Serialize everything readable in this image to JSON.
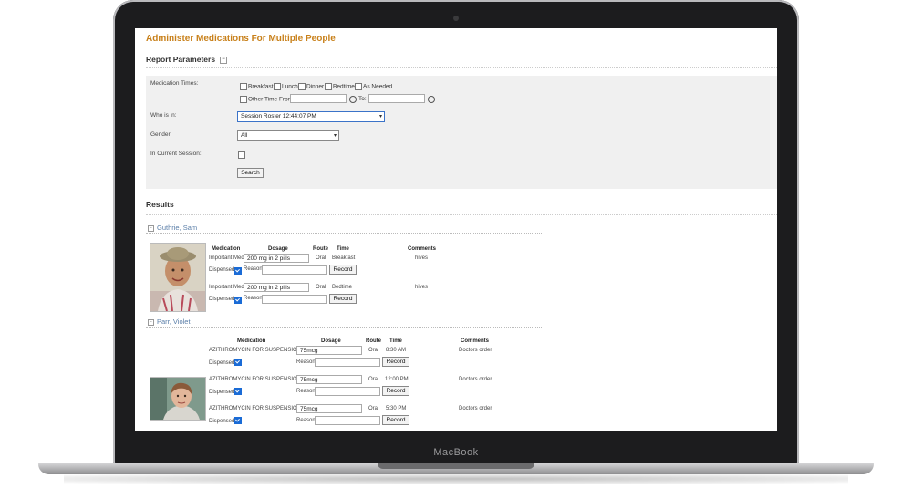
{
  "device": {
    "brand": "MacBook"
  },
  "page": {
    "title": "Administer Medications For Multiple People"
  },
  "report_parameters": {
    "title": "Report Parameters",
    "medication_times_label": "Medication Times:",
    "time_options": [
      "Breakfast",
      "Lunch",
      "Dinner",
      "Bedtime",
      "As Needed"
    ],
    "other_time_from_label": "Other Time From:",
    "to_label": "To:",
    "who_is_in_label": "Who is in:",
    "who_is_in_value": "Session Roster 12:44:07 PM",
    "gender_label": "Gender:",
    "gender_value": "All",
    "in_current_session_label": "In Current Session:",
    "search_button": "Search"
  },
  "results": {
    "title": "Results",
    "headers": {
      "medication": "Medication",
      "dosage": "Dosage",
      "route": "Route",
      "time": "Time",
      "comments": "Comments"
    },
    "labels": {
      "dispensed": "Dispensed",
      "reason": "Reason:",
      "record": "Record"
    },
    "people": [
      {
        "name": "Guthrie, Sam",
        "meds": [
          {
            "medication": "Important Med",
            "dosage": "200 mg in 2 pills",
            "route": "Oral",
            "time": "Breakfast",
            "comments": "hives",
            "dispensed": true
          },
          {
            "medication": "Important Med",
            "dosage": "200 mg in 2 pills",
            "route": "Oral",
            "time": "Bedtime",
            "comments": "hives",
            "dispensed": true
          }
        ]
      },
      {
        "name": "Parr, Violet",
        "meds": [
          {
            "medication": "AZITHROMYCIN FOR SUSPENSION",
            "dosage": "75mcg",
            "route": "Oral",
            "time": "8:30 AM",
            "comments": "Doctors order",
            "dispensed": true
          },
          {
            "medication": "AZITHROMYCIN FOR SUSPENSION",
            "dosage": "75mcg",
            "route": "Oral",
            "time": "12:00 PM",
            "comments": "Doctors order",
            "dispensed": true
          },
          {
            "medication": "AZITHROMYCIN FOR SUSPENSION",
            "dosage": "75mcg",
            "route": "Oral",
            "time": "5:30 PM",
            "comments": "Doctors order",
            "dispensed": true
          }
        ]
      }
    ]
  },
  "colors": {
    "title": "#c8801a",
    "person_link": "#5a7ea8",
    "checkbox": "#1a6bd6"
  }
}
